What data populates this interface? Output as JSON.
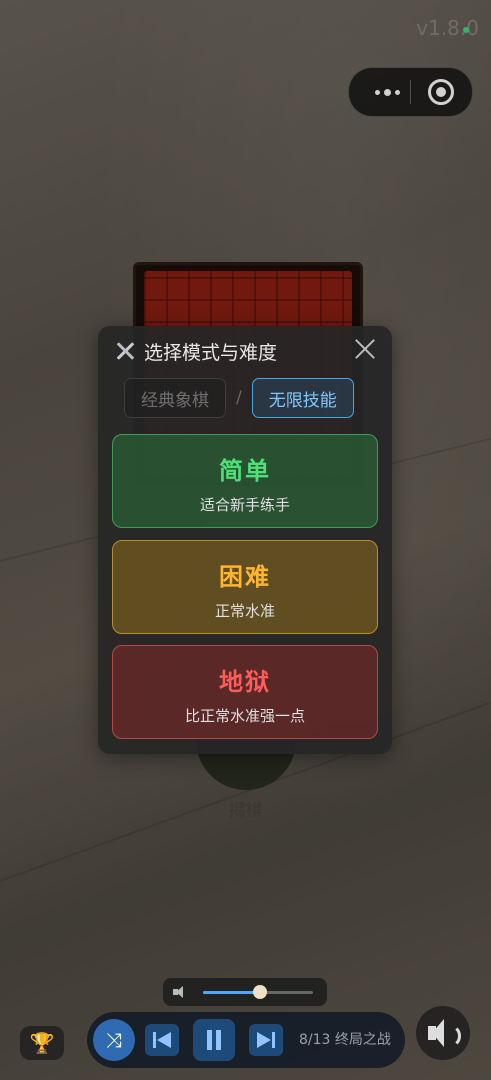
{
  "version": "v1.8.0",
  "background_label": "揭棋",
  "dialog": {
    "title": "选择模式与难度",
    "tabs": [
      {
        "label": "经典象棋",
        "active": false
      },
      {
        "label": "无限技能",
        "active": true
      }
    ],
    "separator": "/",
    "difficulties": [
      {
        "name": "简单",
        "desc": "适合新手练手",
        "color": "#4ee076"
      },
      {
        "name": "困难",
        "desc": "正常水准",
        "color": "#ffb530"
      },
      {
        "name": "地狱",
        "desc": "比正常水准强一点",
        "color": "#ff5b5b"
      }
    ]
  },
  "volume": {
    "level": 0.52
  },
  "player": {
    "track": "8/13 终局之战"
  },
  "icons": {
    "capsule_more": "more-dots-icon",
    "capsule_target": "target-icon",
    "title": "crossed-swords-icon",
    "close": "close-icon",
    "volume": "volume-icon",
    "trophy": "trophy-icon",
    "shuffle": "shuffle-icon",
    "prev": "skip-previous-icon",
    "pause": "pause-icon",
    "next": "skip-next-icon",
    "speaker": "speaker-icon"
  }
}
